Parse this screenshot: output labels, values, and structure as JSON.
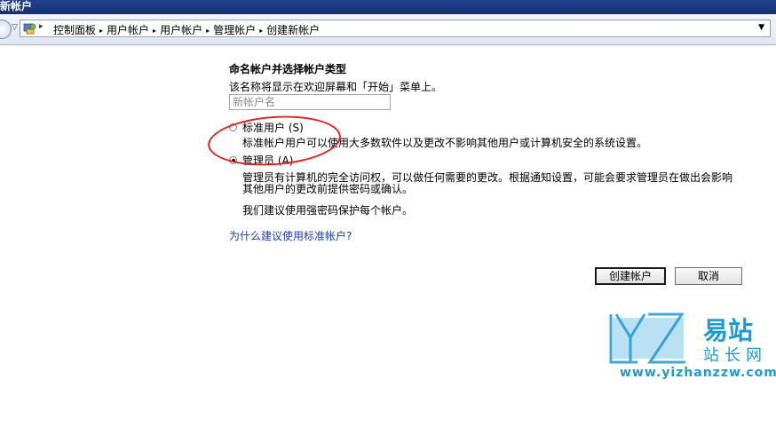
{
  "window": {
    "title": "新帐户"
  },
  "address": {
    "crumbs": [
      "控制面板",
      "用户帐户",
      "用户帐户",
      "管理帐户",
      "创建新帐户"
    ]
  },
  "form": {
    "heading": "命名帐户并选择帐户类型",
    "subtitle": "该名称将显示在欢迎屏幕和「开始」菜单上。",
    "name_placeholder": "新帐户名",
    "options": [
      {
        "label": "标准用户 (S)",
        "desc": "标准帐户用户可以使用大多数软件以及更改不影响其他用户或计算机安全的系统设置。",
        "selected": false
      },
      {
        "label": "管理员 (A)",
        "desc": "管理员有计算机的完全访问权，可以做任何需要的更改。根据通知设置，可能会要求管理员在做出会影响其他用户的更改前提供密码或确认。",
        "selected": true
      }
    ],
    "recommend": "我们建议使用强密码保护每个帐户。",
    "why_link": "为什么建议使用标准帐户?",
    "create_button": "创建帐户",
    "cancel_button": "取消"
  },
  "watermark": {
    "brand_top": "易站",
    "brand_bottom": "站长网",
    "url": "www.yizhanzzw.com"
  },
  "colors": {
    "link": "#1c3fa8",
    "highlight": "#e02020",
    "watermark": "#1b9ad8"
  }
}
